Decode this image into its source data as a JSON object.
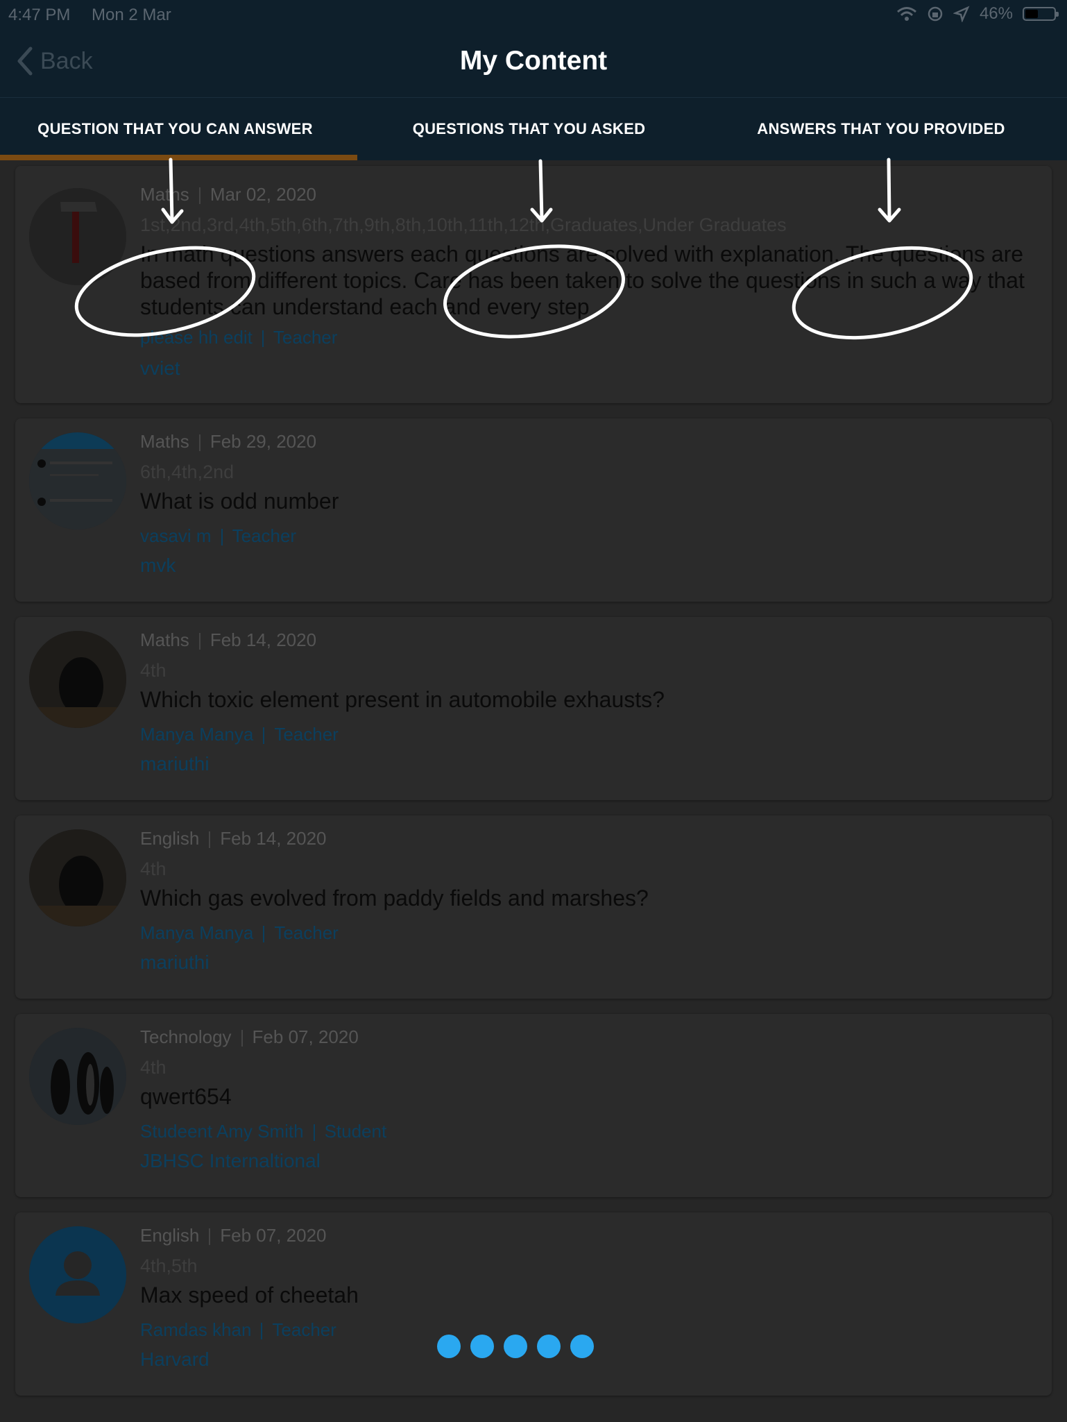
{
  "status": {
    "time": "4:47 PM",
    "date": "Mon 2 Mar",
    "battery": "46%"
  },
  "nav": {
    "back_label": "Back",
    "title": "My Content"
  },
  "tabs": [
    {
      "label": "QUESTION THAT YOU CAN ANSWER"
    },
    {
      "label": "QUESTIONS THAT YOU ASKED"
    },
    {
      "label": "ANSWERS THAT YOU PROVIDED"
    }
  ],
  "cards": [
    {
      "subject": "Maths",
      "date": "Mar 02, 2020",
      "grades": "1st,2nd,3rd,4th,5th,6th,7th,9th,8th,10th,11th,12th,Graduates,Under Graduates",
      "question": "In math questions answers each questions are solved with explanation. The questions are based from different topics. Care has been taken to solve the questions in such a way that students can understand each and every step",
      "author": "please hh edit",
      "role": "Teacher",
      "org": "vviet"
    },
    {
      "subject": "Maths",
      "date": "Feb 29, 2020",
      "grades": "6th,4th,2nd",
      "question": "What is odd number",
      "author": "vasavi m",
      "role": "Teacher",
      "org": "mvk"
    },
    {
      "subject": "Maths",
      "date": "Feb 14, 2020",
      "grades": "4th",
      "question": "Which toxic element present in automobile exhausts?",
      "author": "Manya Manya",
      "role": "Teacher",
      "org": "mariuthi"
    },
    {
      "subject": "English",
      "date": "Feb 14, 2020",
      "grades": "4th",
      "question": "Which gas evolved from  paddy fields and marshes?",
      "author": "Manya Manya",
      "role": "Teacher",
      "org": "mariuthi"
    },
    {
      "subject": "Technology",
      "date": "Feb 07, 2020",
      "grades": "4th",
      "question": "qwert654",
      "author": "Studeent Amy Smith",
      "role": "Student",
      "org": "JBHSC Internaltional"
    },
    {
      "subject": "English",
      "date": "Feb 07, 2020",
      "grades": "4th,5th",
      "question": "Max speed of cheetah",
      "author": "Ramdas khan",
      "role": "Teacher",
      "org": "Harvard"
    }
  ],
  "colors": {
    "header_bg": "#0e1f2b",
    "tab_indicator": "#7a4a12",
    "link_blue": "#0b3f5e",
    "loader_dot": "#2aa8f0"
  }
}
